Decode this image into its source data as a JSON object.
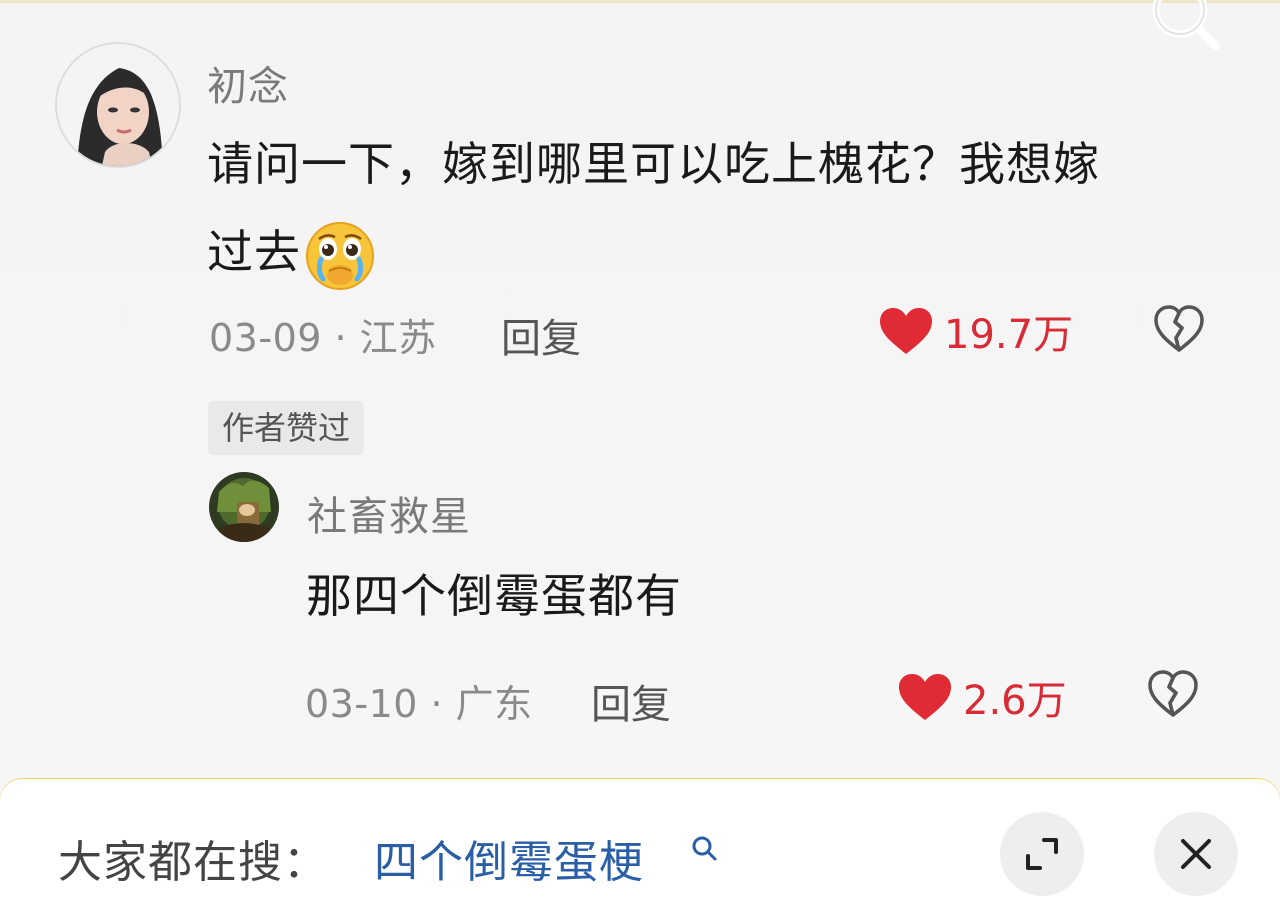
{
  "comment": {
    "username": "初念",
    "text_line1": "请问一下，嫁到哪里可以吃上槐花？我想嫁",
    "text_line2": "过去",
    "emoji": "pleading-tearful-face",
    "meta": "03-09 · 江苏",
    "reply_label": "回复",
    "likes": "19.7万"
  },
  "author_liked_badge": "作者赞过",
  "reply": {
    "username": "社畜救星",
    "text": "那四个倒霉蛋都有",
    "meta": "03-10 · 广东",
    "reply_label": "回复",
    "likes": "2.6万"
  },
  "bottom_bar": {
    "label": "大家都在搜：",
    "query": "四个倒霉蛋梗"
  },
  "colors": {
    "like_red": "#d82b35",
    "query_blue": "#2a5fa8",
    "accent_yellow": "#f4cf4b"
  }
}
